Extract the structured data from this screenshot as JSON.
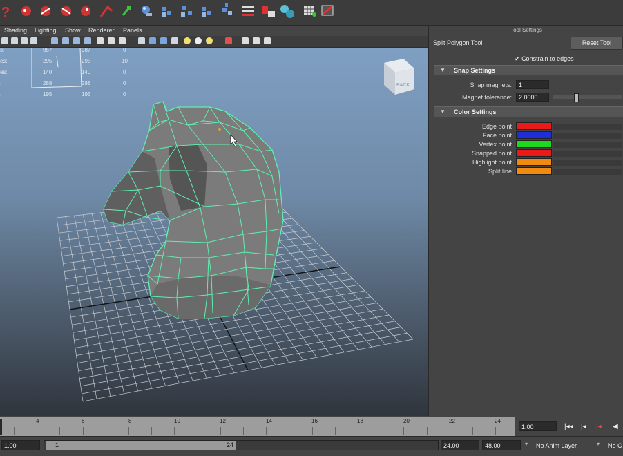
{
  "menu": [
    "Shading",
    "Lighting",
    "Show",
    "Renderer",
    "Panels"
  ],
  "hud": {
    "rows": [
      {
        "label": "s:",
        "a": "957",
        "b": "987",
        "c": "0"
      },
      {
        "label": "es:",
        "a": "295",
        "b": "295",
        "c": "10"
      },
      {
        "label": "es:",
        "a": "140",
        "b": "140",
        "c": "0"
      },
      {
        "label": ":",
        "a": "288",
        "b": "288",
        "c": "0"
      },
      {
        "label": ":",
        "a": "195",
        "b": "195",
        "c": "0"
      }
    ]
  },
  "viewcube_label": "BACK",
  "panel": {
    "title": "Tool Settings",
    "tool_name": "Split Polygon Tool",
    "reset_label": "Reset Tool",
    "constrain_label": "Constrain to edges",
    "snap_header": "Snap Settings",
    "snap_magnets_label": "Snap magnets:",
    "snap_magnets_value": "1",
    "magnet_tolerance_label": "Magnet tolerance:",
    "magnet_tolerance_value": "2.0000",
    "color_header": "Color Settings",
    "colors": [
      {
        "label": "Edge point",
        "color": "#e81a1a"
      },
      {
        "label": "Face point",
        "color": "#1f2fd8"
      },
      {
        "label": "Vertex point",
        "color": "#1ed81e"
      },
      {
        "label": "Snapped point",
        "color": "#e81a1a"
      },
      {
        "label": "Highlight point",
        "color": "#f08a10"
      },
      {
        "label": "Split line",
        "color": "#f08a10"
      }
    ]
  },
  "timeline": {
    "ticks": [
      "4",
      "6",
      "8",
      "10",
      "12",
      "14",
      "16",
      "18",
      "20",
      "22",
      "24"
    ],
    "current_frame": "1.00"
  },
  "range": {
    "start": "1.00",
    "handle_start": "1",
    "handle_end": "24",
    "end": "24.00",
    "anim_end": "48.00",
    "anim_layer": "No Anim Layer",
    "character": "No C"
  },
  "colors": {
    "wire": "#5ef0b0",
    "mesh": "#7a7a7a"
  }
}
